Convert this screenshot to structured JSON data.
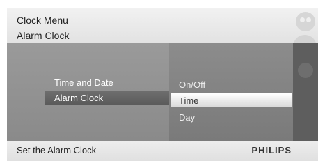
{
  "header": {
    "title": "Clock Menu",
    "subtitle": "Alarm Clock"
  },
  "left_menu": {
    "items": [
      {
        "label": "Time and Date"
      },
      {
        "label": "Alarm Clock"
      }
    ],
    "selected_index": 1
  },
  "sub_menu": {
    "items": [
      {
        "label": "On/Off"
      },
      {
        "label": "Time"
      },
      {
        "label": "Day"
      }
    ],
    "selected_index": 1
  },
  "footer": {
    "hint": "Set the Alarm Clock",
    "brand": "PHILIPS"
  }
}
